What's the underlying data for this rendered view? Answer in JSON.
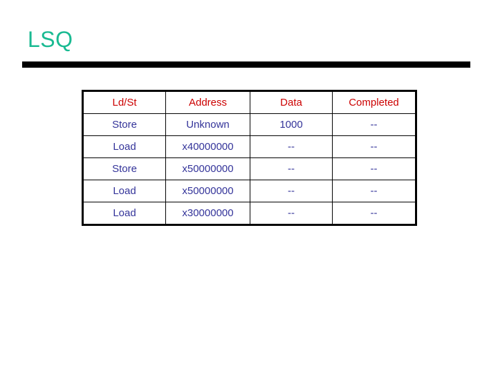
{
  "slide": {
    "title": "LSQ",
    "title_color": "#1aba92",
    "rule_color": "#000000"
  },
  "table": {
    "header_color": "#cc0000",
    "cell_color": "#333399",
    "border_color": "#000000",
    "columns": [
      "Ld/St",
      "Address",
      "Data",
      "Completed"
    ],
    "rows": [
      [
        "Store",
        "Unknown",
        "1000",
        "--"
      ],
      [
        "Load",
        "x40000000",
        "--",
        "--"
      ],
      [
        "Store",
        "x50000000",
        "--",
        "--"
      ],
      [
        "Load",
        "x50000000",
        "--",
        "--"
      ],
      [
        "Load",
        "x30000000",
        "--",
        "--"
      ]
    ]
  }
}
